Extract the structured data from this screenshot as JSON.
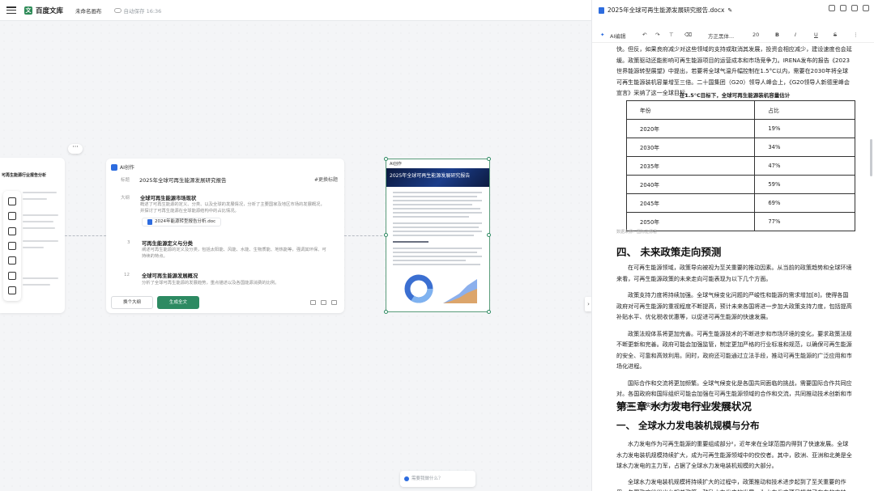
{
  "app": {
    "brand": "百度文库",
    "doc_tag": "未命名画布",
    "save_status": "自动保存 16:36"
  },
  "left_card": {
    "title": "可再生能源行业报告分析"
  },
  "ai_card": {
    "header": "AI创作",
    "label_title": "标题",
    "label_outline": "大纲",
    "doc_title": "2025年全球可再生能源发展研究报告",
    "refresh": "#更换标题",
    "sections": [
      {
        "num": "",
        "heading": "全球可再生能源市场现状",
        "text1": "概述了可再生能源的定义、分类、以及全球的发展情况，分析了主要国家及地区市场的发展概况，并探讨了可再生能源在全球能源结构中的占比情况。"
      },
      {
        "num": "3",
        "heading": "可再生能源定义与分类",
        "text1": "阐述可再生能源的定义及分类，包括太阳能、风能、水能、生物质能、地热能等，强调其环保、可持续的特点。"
      },
      {
        "num": "12",
        "heading": "全球可再生能源发展概况",
        "text1": "分析了全球可再生能源的发展趋势，重点描述以及各国能源消费的比例。"
      }
    ],
    "chip": "2024年能源转型报告分析.doc",
    "btn_secondary": "换个大纲",
    "btn_primary": "生成全文"
  },
  "thumb": {
    "label": "AI创作",
    "banner_title": "2025年全球可再生能源发展研究报告"
  },
  "ask": {
    "placeholder": "需要我做什么？"
  },
  "doc": {
    "filename": "2025年全球可再生能源发展研究报告.docx",
    "toolbar": {
      "ai": "AI编辑",
      "font": "方正黑体...",
      "size": "20",
      "bold": "B",
      "italic": "I",
      "underline": "U",
      "strike": "S"
    },
    "intro_paras": [
      "快。但反，如果良府减少对这些领域的支持或取消其发展，投资会相应减少，建设速度也会延缓。政策驱动还能影响可再生能源项目的运营成本和市场竞争力。IRENA发布的报告《2023世界能源转型展望》中提出，若要将全球气温升幅控制在1.5°C以内，需要在2030年将全球可再生能源装机容量增至三倍。二十国集团（G20）领导人峰会上，《G20领导人新德里峰会宣言》采纳了这一全球目标。"
    ],
    "table_caption": "在1.5°C目标下，全球可再生能源装机容量估计",
    "table": {
      "headers": [
        "年份",
        "占比"
      ],
      "rows": [
        [
          "2020年",
          "19%"
        ],
        [
          "2030年",
          "34%"
        ],
        [
          "2035年",
          "47%"
        ],
        [
          "2040年",
          "59%"
        ],
        [
          "2045年",
          "69%"
        ],
        [
          "2050年",
          "77%"
        ]
      ]
    },
    "table_source": "数据来源：国际能源署",
    "h_policy": "四、 未来政策走向预测",
    "policy_paras": [
      "在可再生能源领域，政策导向被视为至关重要的推动因素。从当前的政策趋势和全球环境来看，可再生能源政策的未来走向可能表现为以下几个方面。",
      "政策支持力度将持续加强。全球气候变化问题的严峻性和能源的需求增加[8]，使得各国政府对可再生能源的重视程度不断提高，预计未来各国将进一步加大政策支持力度，包括提高补贴水平、优化税收优惠等，以促进可再生能源的快速发展。",
      "政策法规体系将更加完善。可再生能源技术的不断进步和市场环境的变化，要求政策法规不断更新和完善。政府可能会加强监管，制定更加严格的行业标准和规范，以确保可再生能源的安全、可靠和高效利用。同时，政府还可能通过立法手段，推动可再生能源的广泛应用和市场化进程。",
      "国际合作和交流将更加频繁。全球气候变化是各国共同面临的挑战，需要国际合作共同应对。各国政府和国际组织可能会加强在可再生能源领域的合作和交流，共同推动技术创新和市场拓展，以实现全球可再生能源的可持续发展。"
    ],
    "h_chapter3": "第三章 水力发电行业发展状况",
    "h_section1": "一、 全球水力发电装机规模与分布",
    "hydro_paras": [
      "水力发电作为可再生能源的重要组成部分²，近年来在全球范围内得到了快速发展。全球水力发电装机规模持续扩大，成为可再生能源领域中的佼佼者。其中，欧洲、亚洲和北美是全球水力发电的主力军，占据了全球水力发电装机规模的大部分。",
      "全球水力发电装机规模将持续扩大的过程中，政策推动和技术进步起到了至关重要的作用。各国政府纷纷出台相关政策，鼓励水力发电的发展，为水力发电项目提供了有力的支持。同时，水力"
    ]
  }
}
